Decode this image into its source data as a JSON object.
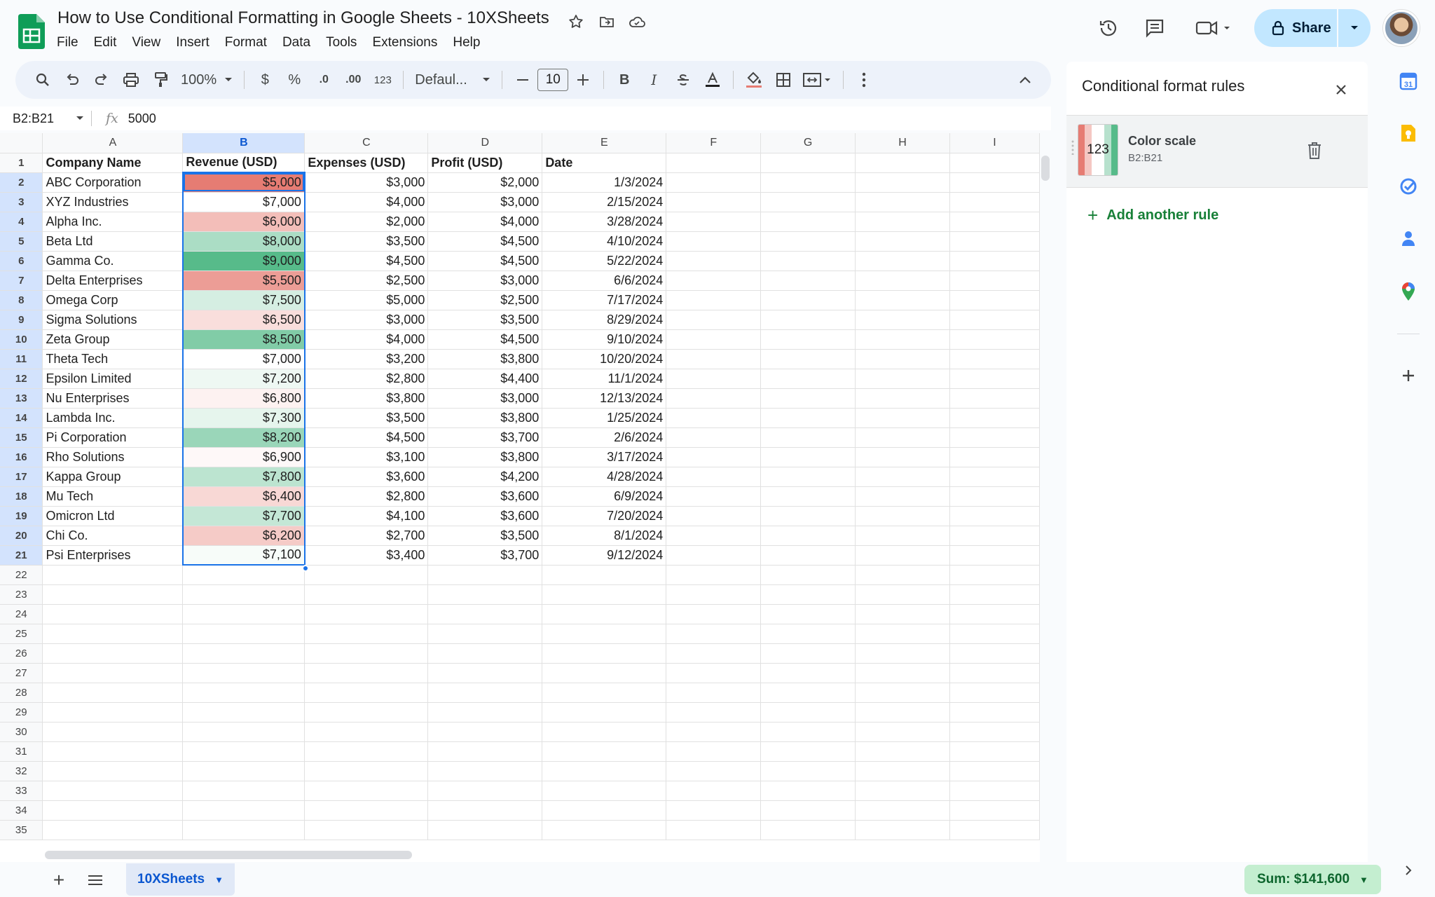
{
  "app": {
    "title": "How to Use Conditional Formatting in Google Sheets - 10XSheets",
    "menu": [
      "File",
      "Edit",
      "View",
      "Insert",
      "Format",
      "Data",
      "Tools",
      "Extensions",
      "Help"
    ],
    "share_label": "Share"
  },
  "toolbar": {
    "zoom": "100%",
    "currency": "$",
    "percent": "%",
    "decrease_decimal": ".0",
    "increase_decimal": ".00",
    "number_format": "123",
    "font": "Defaul...",
    "font_size": "10",
    "bold": "B",
    "italic": "I"
  },
  "formula_bar": {
    "cell_ref": "B2:B21",
    "fx_label": "fx",
    "value": "5000"
  },
  "grid": {
    "columns": [
      "A",
      "B",
      "C",
      "D",
      "E",
      "F",
      "G",
      "H",
      "I"
    ],
    "header_row": [
      "Company Name",
      "Revenue (USD)",
      "Expenses (USD)",
      "Profit (USD)",
      "Date"
    ],
    "rows": [
      [
        "ABC Corporation",
        "$5,000",
        "$3,000",
        "$2,000",
        "1/3/2024"
      ],
      [
        "XYZ Industries",
        "$7,000",
        "$4,000",
        "$3,000",
        "2/15/2024"
      ],
      [
        "Alpha Inc.",
        "$6,000",
        "$2,000",
        "$4,000",
        "3/28/2024"
      ],
      [
        "Beta Ltd",
        "$8,000",
        "$3,500",
        "$4,500",
        "4/10/2024"
      ],
      [
        "Gamma Co.",
        "$9,000",
        "$4,500",
        "$4,500",
        "5/22/2024"
      ],
      [
        "Delta Enterprises",
        "$5,500",
        "$2,500",
        "$3,000",
        "6/6/2024"
      ],
      [
        "Omega Corp",
        "$7,500",
        "$5,000",
        "$2,500",
        "7/17/2024"
      ],
      [
        "Sigma Solutions",
        "$6,500",
        "$3,000",
        "$3,500",
        "8/29/2024"
      ],
      [
        "Zeta Group",
        "$8,500",
        "$4,000",
        "$4,500",
        "9/10/2024"
      ],
      [
        "Theta Tech",
        "$7,000",
        "$3,200",
        "$3,800",
        "10/20/2024"
      ],
      [
        "Epsilon Limited",
        "$7,200",
        "$2,800",
        "$4,400",
        "11/1/2024"
      ],
      [
        "Nu Enterprises",
        "$6,800",
        "$3,800",
        "$3,000",
        "12/13/2024"
      ],
      [
        "Lambda Inc.",
        "$7,300",
        "$3,500",
        "$3,800",
        "1/25/2024"
      ],
      [
        "Pi Corporation",
        "$8,200",
        "$4,500",
        "$3,700",
        "2/6/2024"
      ],
      [
        "Rho Solutions",
        "$6,900",
        "$3,100",
        "$3,800",
        "3/17/2024"
      ],
      [
        "Kappa Group",
        "$7,800",
        "$3,600",
        "$4,200",
        "4/28/2024"
      ],
      [
        "Mu Tech",
        "$6,400",
        "$2,800",
        "$3,600",
        "6/9/2024"
      ],
      [
        "Omicron Ltd",
        "$7,700",
        "$4,100",
        "$3,600",
        "7/20/2024"
      ],
      [
        "Chi Co.",
        "$6,200",
        "$2,700",
        "$3,500",
        "8/1/2024"
      ],
      [
        "Psi Enterprises",
        "$7,100",
        "$3,400",
        "$3,700",
        "9/12/2024"
      ]
    ],
    "revenue_values": [
      5000,
      7000,
      6000,
      8000,
      9000,
      5500,
      7500,
      6500,
      8500,
      7000,
      7200,
      6800,
      7300,
      8200,
      6900,
      7800,
      6400,
      7700,
      6200,
      7100
    ],
    "visible_row_count": 35,
    "color_scale": {
      "min_color": "#e67c73",
      "mid_color": "#ffffff",
      "max_color": "#57bb8a"
    }
  },
  "bottom": {
    "sheet_tab": "10XSheets",
    "sum_label": "Sum: $141,600"
  },
  "panel": {
    "title": "Conditional format rules",
    "rule": {
      "swatch_label": "123",
      "name": "Color scale",
      "range": "B2:B21"
    },
    "add_rule_label": "Add another rule"
  },
  "colors": {
    "accent": "#1a73e8",
    "share_bg": "#c2e7ff",
    "add_rule": "#188038",
    "sum_bg": "#c4eed0"
  }
}
